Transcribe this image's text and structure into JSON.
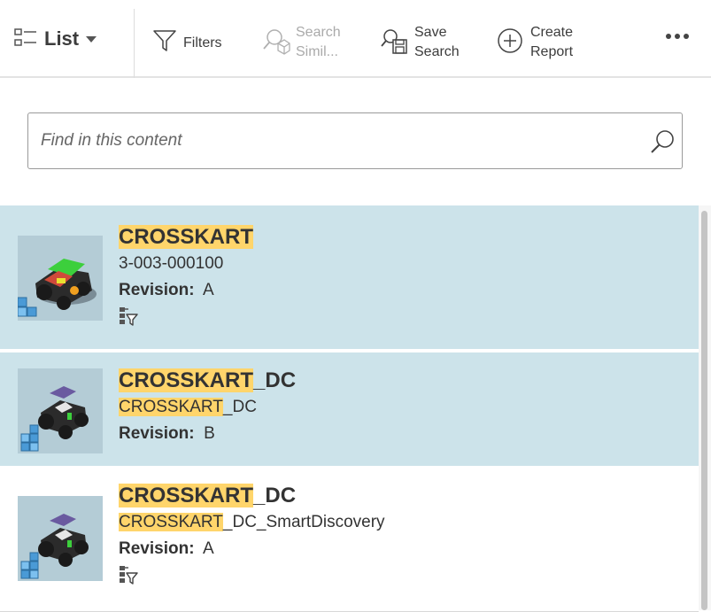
{
  "toolbar": {
    "view_label": "List",
    "filters_label": "Filters",
    "search_similar_label": [
      "Search",
      "Simil..."
    ],
    "save_search_label": [
      "Save",
      "Search"
    ],
    "create_report_label": [
      "Create",
      "Report"
    ]
  },
  "search": {
    "placeholder": "Find in this content",
    "value": ""
  },
  "results": [
    {
      "title_highlight": "CROSSKART",
      "title_rest": "",
      "id_highlight": "",
      "id_rest": "3-003-000100",
      "revision_label": "Revision:",
      "revision_value": "A",
      "selected": true,
      "has_structure_icon": true
    },
    {
      "title_highlight": "CROSSKART",
      "title_rest": "_DC",
      "id_highlight": "CROSSKART",
      "id_rest": "_DC",
      "revision_label": "Revision:",
      "revision_value": "B",
      "selected": true,
      "has_structure_icon": false
    },
    {
      "title_highlight": "CROSSKART",
      "title_rest": "_DC",
      "id_highlight": "CROSSKART",
      "id_rest": "_DC_SmartDiscovery",
      "revision_label": "Revision:",
      "revision_value": "A",
      "selected": false,
      "has_structure_icon": true
    }
  ],
  "colors": {
    "selected_bg": "#cce3ea",
    "highlight": "#ffd56b",
    "thumbnail_bg": "#b4ccd6",
    "assembly_icon": "#4a9ad6"
  }
}
